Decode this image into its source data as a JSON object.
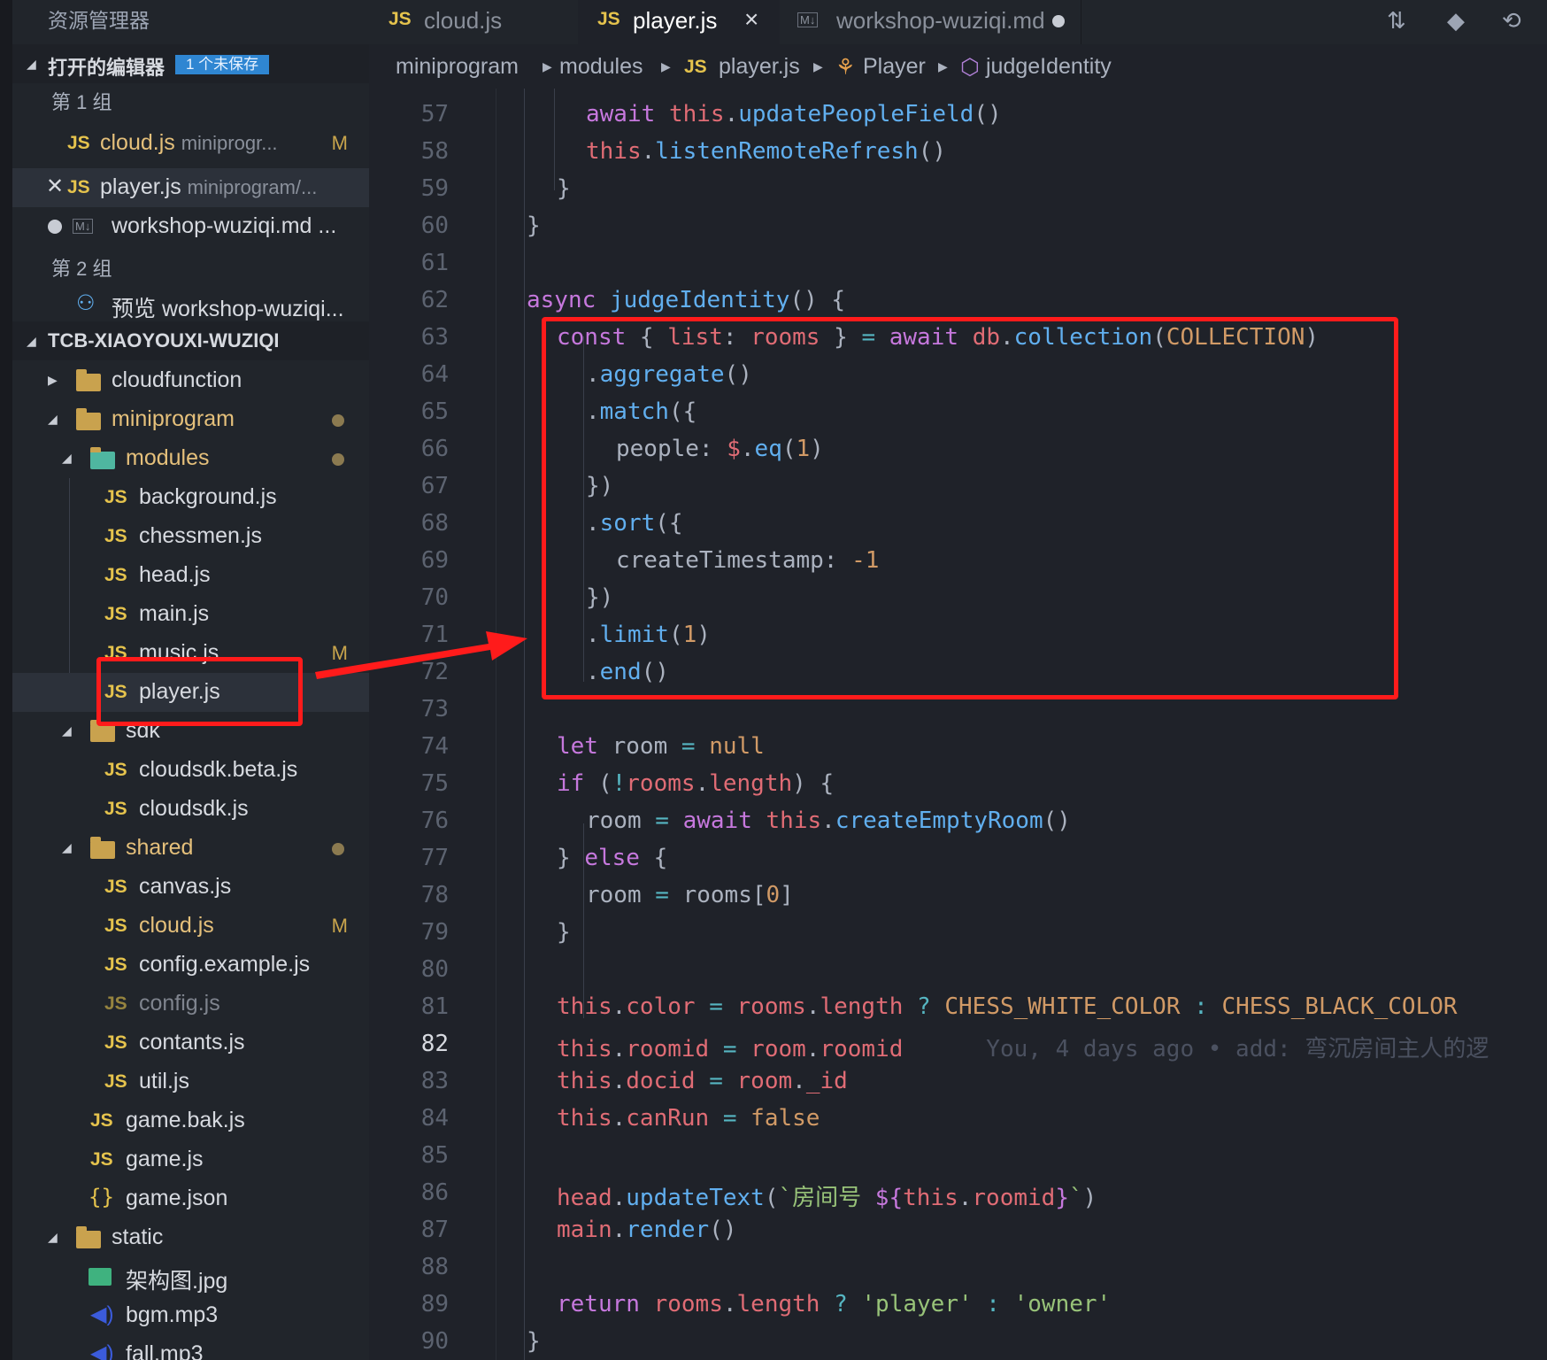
{
  "sidebar": {
    "title": "资源管理器",
    "open_editors": {
      "label": "打开的编辑器",
      "badge": "1 个未保存"
    },
    "group1": "第 1 组",
    "group2": "第 2 组",
    "open_files": [
      {
        "icon": "JS",
        "name": "cloud.js",
        "path": "miniprogr...",
        "status": "M"
      },
      {
        "icon": "JS",
        "name": "player.js",
        "path": "miniprogram/..."
      },
      {
        "icon": "M↓",
        "name": "workshop-wuziqi.md",
        "path": "..."
      }
    ],
    "preview": "预览 workshop-wuziqi...",
    "workspace": "TCB-XIAOYOUXI-WUZIQI",
    "tree": {
      "cloudfunction": "cloudfunction",
      "miniprogram": "miniprogram",
      "modules": "modules",
      "modules_files": [
        "background.js",
        "chessmen.js",
        "head.js",
        "main.js",
        "music.js",
        "player.js"
      ],
      "music_status": "M",
      "sdk": "sdk",
      "sdk_files": [
        "cloudsdk.beta.js",
        "cloudsdk.js"
      ],
      "shared": "shared",
      "shared_files": [
        "canvas.js",
        "cloud.js",
        "config.example.js",
        "config.js",
        "contants.js",
        "util.js"
      ],
      "cloud_status": "M",
      "root_files": [
        "game.bak.js",
        "game.js",
        "game.json"
      ],
      "static": "static",
      "static_files": [
        "架构图.jpg",
        "bgm.mp3",
        "fall.mp3"
      ]
    }
  },
  "tabs": [
    {
      "icon": "JS",
      "label": "cloud.js"
    },
    {
      "icon": "JS",
      "label": "player.js",
      "close": "×"
    },
    {
      "icon": "M↓",
      "label": "workshop-wuziqi.md"
    }
  ],
  "breadcrumb": [
    "miniprogram",
    "modules",
    "player.js",
    "Player",
    "judgeIdentity"
  ],
  "editor": {
    "line_numbers": [
      "57",
      "58",
      "59",
      "60",
      "61",
      "62",
      "63",
      "64",
      "65",
      "66",
      "67",
      "68",
      "69",
      "70",
      "71",
      "72",
      "73",
      "74",
      "75",
      "76",
      "77",
      "78",
      "79",
      "80",
      "81",
      "82",
      "83",
      "84",
      "85",
      "86",
      "87",
      "88",
      "89",
      "90"
    ],
    "current_line": "82",
    "blame": "You, 4 days ago • add: 弯沉房间主人的逻",
    "colors": {
      "keyword": "#c678dd",
      "function": "#61afef",
      "variable": "#e06c75",
      "number": "#d19a66",
      "string": "#98c379",
      "operator": "#56b6c2",
      "plain": "#abb2bf",
      "highlight": "#ff1b1b"
    }
  }
}
